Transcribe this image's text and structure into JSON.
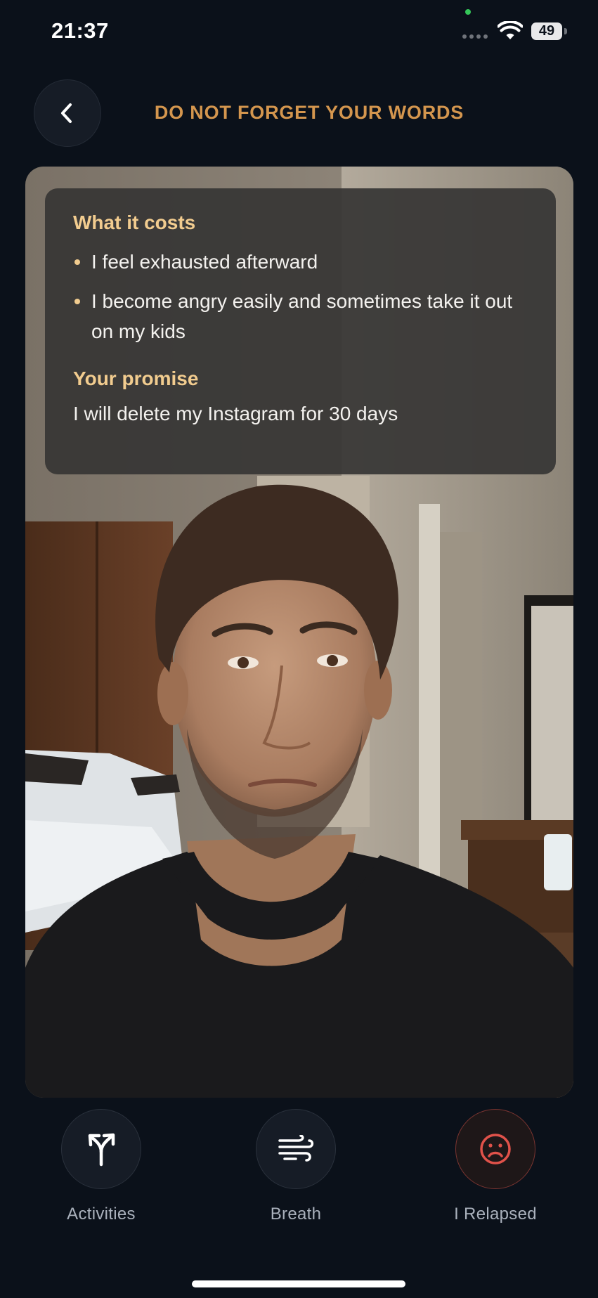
{
  "status_bar": {
    "time": "21:37",
    "battery": "49"
  },
  "header": {
    "title": "DO NOT FORGET YOUR WORDS",
    "back_icon": "chevron-left-icon"
  },
  "card": {
    "costs_title": "What it costs",
    "costs": [
      "I feel exhausted afterward",
      "I become angry easily and sometimes take it out on my kids"
    ],
    "promise_title": "Your promise",
    "promise": "I will delete my Instagram for 30 days",
    "photo": "selfie of a man in a bedroom"
  },
  "actions": [
    {
      "label": "Activities",
      "icon": "split-arrows-icon"
    },
    {
      "label": "Breath",
      "icon": "wind-icon"
    },
    {
      "label": "I Relapsed",
      "icon": "sad-face-icon"
    }
  ],
  "colors": {
    "background": "#0b111a",
    "accent": "#d4964e",
    "panel_heading": "#f2cc8f",
    "danger": "#e0524a"
  }
}
